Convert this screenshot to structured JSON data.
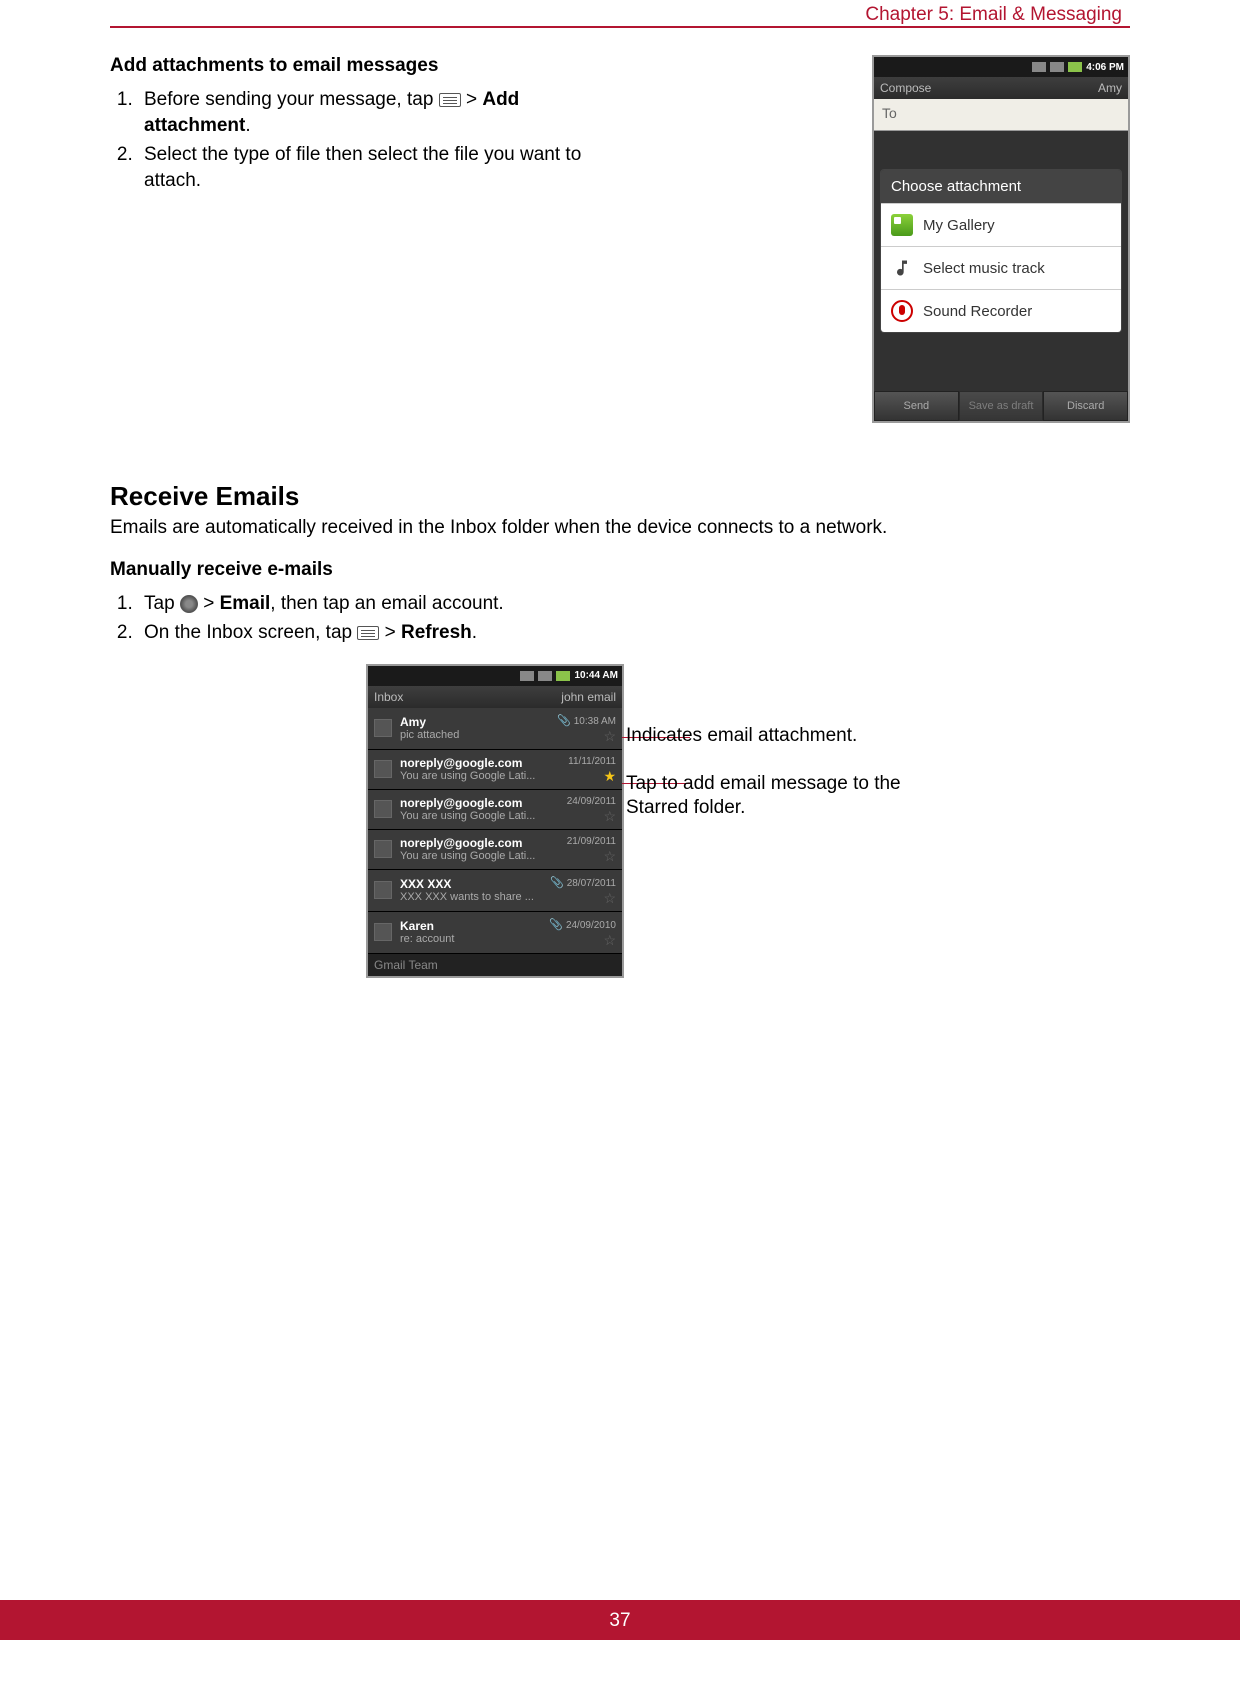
{
  "chapter": "Chapter 5: Email & Messaging",
  "page_number": "37",
  "section1": {
    "title": "Add attachments to email messages",
    "step1_a": "Before sending your message, tap ",
    "step1_b": " > ",
    "step1_bold": "Add attachment",
    "step1_c": ".",
    "step2": "Select the type of file then select the file you want to attach."
  },
  "phone1": {
    "time": "4:06 PM",
    "compose": "Compose",
    "account": "Amy",
    "to": "To",
    "dialog_title": "Choose attachment",
    "items": [
      "My Gallery",
      "Select music track",
      "Sound Recorder"
    ],
    "buttons": [
      "Send",
      "Save as draft",
      "Discard"
    ]
  },
  "section2": {
    "title": "Receive Emails",
    "intro": "Emails are automatically received in the Inbox folder when the device connects to a network.",
    "subtitle": "Manually receive e-mails",
    "step1_a": "Tap ",
    "step1_b": " > ",
    "step1_bold": "Email",
    "step1_c": ", then tap an email account.",
    "step2_a": "On the Inbox screen, tap ",
    "step2_b": " > ",
    "step2_bold": "Refresh",
    "step2_c": "."
  },
  "phone2": {
    "time": "10:44 AM",
    "left": "Inbox",
    "right": "john email",
    "emails": [
      {
        "sender": "Amy",
        "sub": "pic attached",
        "date": "10:38 AM",
        "clip": true,
        "star": false
      },
      {
        "sender": "noreply@google.com",
        "sub": "You are using Google Lati...",
        "date": "11/11/2011",
        "clip": false,
        "star": true
      },
      {
        "sender": "noreply@google.com",
        "sub": "You are using Google Lati...",
        "date": "24/09/2011",
        "clip": false,
        "star": false
      },
      {
        "sender": "noreply@google.com",
        "sub": "You are using Google Lati...",
        "date": "21/09/2011",
        "clip": false,
        "star": false
      },
      {
        "sender": "XXX XXX",
        "sub": "XXX XXX wants to share ...",
        "date": "28/07/2011",
        "clip": true,
        "star": false
      },
      {
        "sender": "Karen",
        "sub": "re: account",
        "date": "24/09/2010",
        "clip": true,
        "star": false
      }
    ],
    "last": "Gmail Team"
  },
  "callouts": {
    "c1": "Indicates email attachment.",
    "c2": "Tap to add email message to the Starred folder."
  }
}
